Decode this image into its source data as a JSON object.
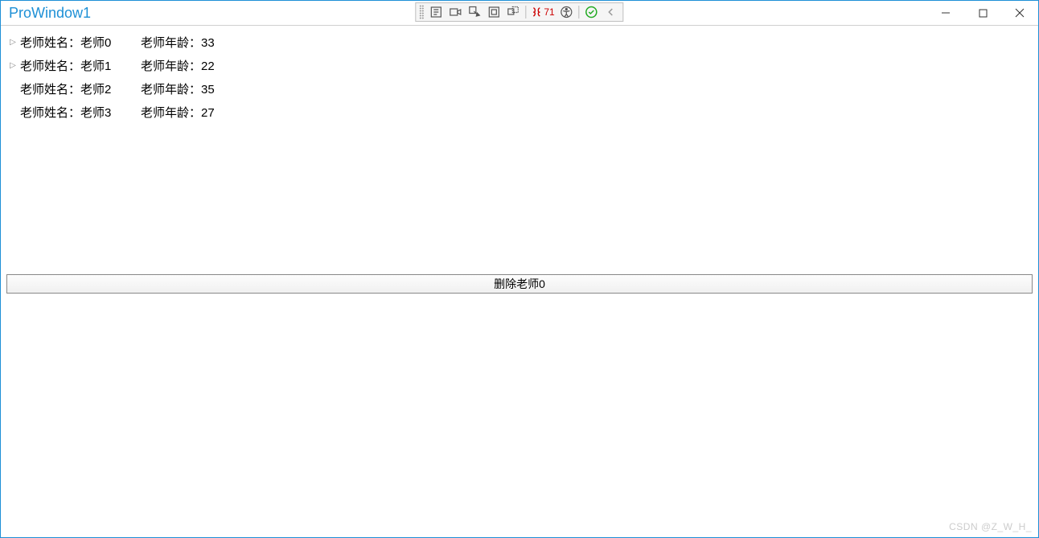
{
  "window": {
    "title": "ProWindow1"
  },
  "debug_toolbar": {
    "counter_value": "71"
  },
  "labels": {
    "name_label": "老师姓名：",
    "age_label": "老师年龄："
  },
  "teachers": [
    {
      "expandable": true,
      "name": "老师0",
      "age": "33"
    },
    {
      "expandable": true,
      "name": "老师1",
      "age": "22"
    },
    {
      "expandable": false,
      "name": "老师2",
      "age": "35"
    },
    {
      "expandable": false,
      "name": "老师3",
      "age": "27"
    }
  ],
  "button": {
    "delete_label": "删除老师0"
  },
  "watermark": "CSDN @Z_W_H_"
}
